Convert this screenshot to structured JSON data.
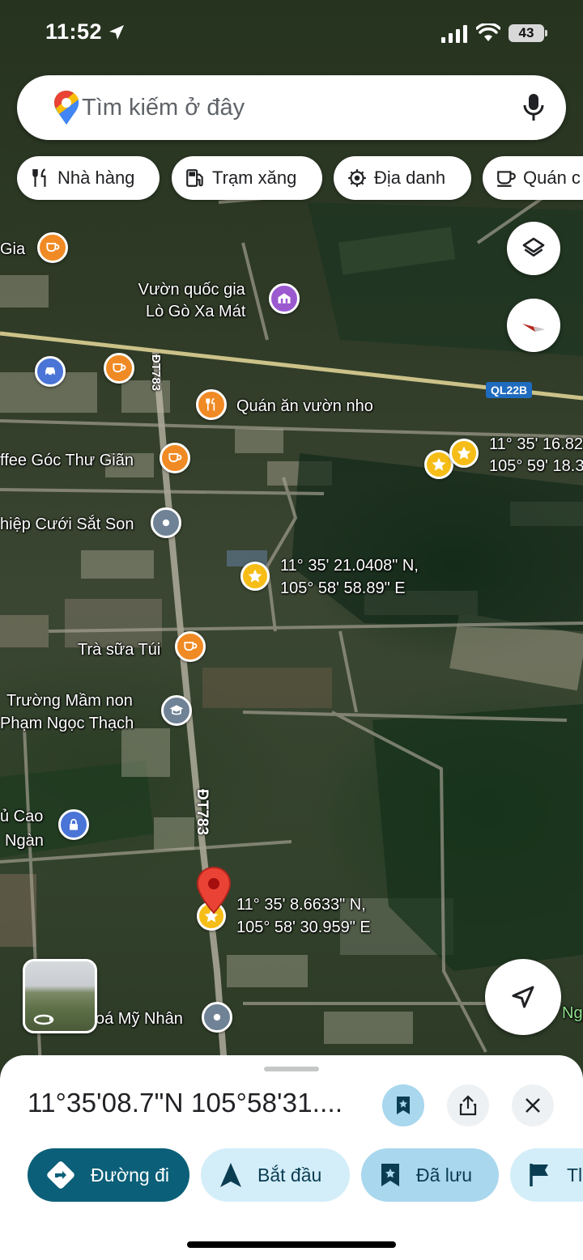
{
  "status_bar": {
    "time": "11:52",
    "battery": "43"
  },
  "search": {
    "placeholder": "Tìm kiếm ở đây"
  },
  "chips": [
    {
      "label": "Nhà hàng",
      "icon": "restaurant-icon"
    },
    {
      "label": "Trạm xăng",
      "icon": "gas-station-icon"
    },
    {
      "label": "Địa danh",
      "icon": "landmark-icon"
    },
    {
      "label": "Quán c",
      "icon": "coffee-icon"
    }
  ],
  "map": {
    "roads": {
      "dt783_top": "ĐT783",
      "dt783_bottom": "ĐT783",
      "ql22b": "QL22B"
    },
    "places": {
      "gia": "Gia",
      "park_line1": "Vườn quốc gia",
      "park_line2": "Lò Gò Xa Mát",
      "restaurant": "Quán ăn vườn nho",
      "coffee": "ffee Góc Thư Giãn",
      "wedding": "hiệp Cưới Sắt Son",
      "milk_tea": "Trà sữa Túi",
      "school_line1": "Trường Mầm non",
      "school_line2": "Phạm Ngọc Thạch",
      "left_line1": "ủ Cao",
      "left_line2": "Ngàn",
      "bottom_place": "oá Mỹ Nhân",
      "edge_right": "Ng"
    },
    "saved_pins": {
      "pin_right_lat": "11° 35' 16.82",
      "pin_right_lng": "105° 59' 18.3",
      "pin_mid_lat": "11° 35' 21.0408\" N,",
      "pin_mid_lng": "105° 58' 58.89\" E",
      "pin_main_lat": "11° 35' 8.6633\" N,",
      "pin_main_lng": "105° 58' 30.959\" E"
    }
  },
  "sheet": {
    "title": "11°35'08.7\"N 105°58'31....",
    "actions": {
      "directions": "Đường đi",
      "start": "Bắt đầu",
      "saved": "Đã lưu",
      "label_more": "Tl"
    }
  },
  "colors": {
    "primary_dark": "#0b5f78",
    "tonal": "#d3eef9",
    "tonal_saved": "#a8d7ee",
    "pin_red": "#ea4335",
    "star_yellow": "#f6bd16"
  }
}
